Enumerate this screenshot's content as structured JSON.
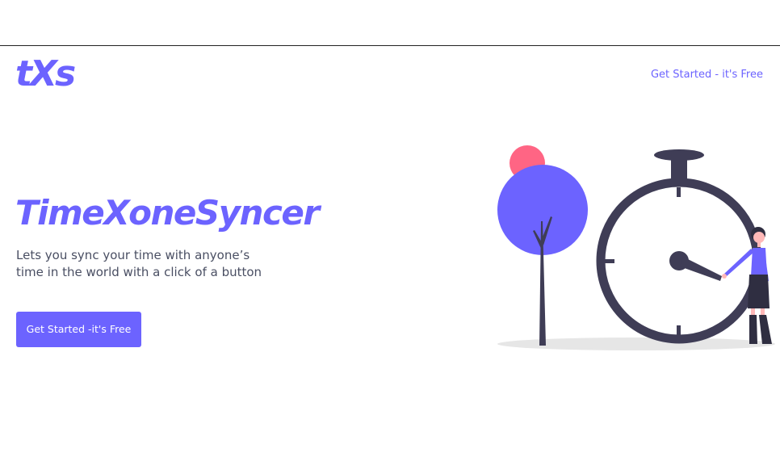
{
  "header": {
    "logo_text": "tXs",
    "cta_label": "Get Started - it's Free"
  },
  "hero": {
    "title": "TimeXoneSyncer",
    "subtitle": "Lets you sync your time with anyone’s time in the world with a click of a button",
    "button_label": "Get Started -it's Free"
  },
  "theme": {
    "accent": "#6c63ff",
    "dark": "#3f3d56",
    "pink": "#ff6584",
    "shadow": "#e6e6e6"
  },
  "illustration": {
    "icon": "stopwatch-illustration"
  }
}
